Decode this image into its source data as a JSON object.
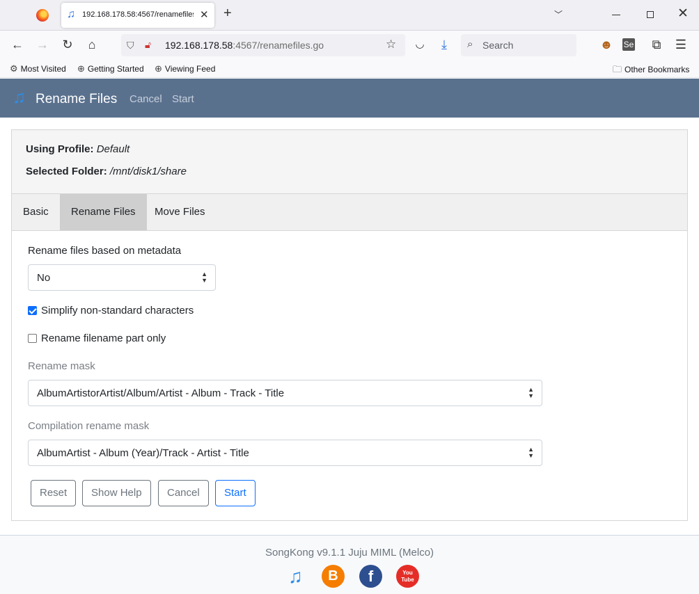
{
  "browser": {
    "tab_title": "192.168.178.58:4567/renamefiles.go",
    "new_tab_symbol": "+",
    "url_host": "192.168.178.58",
    "url_rest": ":4567/renamefiles.go",
    "search_placeholder": "Search",
    "bookmarks": [
      {
        "label": "Most Visited",
        "icon": "gear-icon"
      },
      {
        "label": "Getting Started",
        "icon": "globe-icon"
      },
      {
        "label": "Viewing Feed",
        "icon": "globe-icon"
      },
      {
        "label": "Other Bookmarks",
        "icon": "folder-icon"
      }
    ]
  },
  "app": {
    "brand": "Rename Files",
    "nav": {
      "cancel": "Cancel",
      "start": "Start"
    },
    "profile_label": "Using Profile:",
    "profile_value": "Default",
    "folder_label": "Selected Folder:",
    "folder_value": "/mnt/disk1/share",
    "tabs": [
      {
        "label": "Basic",
        "active": false
      },
      {
        "label": "Rename Files",
        "active": true
      },
      {
        "label": "Move Files",
        "active": false
      }
    ],
    "form": {
      "rename_metadata_label": "Rename files based on metadata",
      "rename_metadata_value": "No",
      "simplify_label": "Simplify non-standard characters",
      "simplify_checked": true,
      "filename_only_label": "Rename filename part only",
      "filename_only_checked": false,
      "mask_label": "Rename mask",
      "mask_value": "AlbumArtistorArtist/Album/Artist - Album - Track - Title",
      "compilation_label": "Compilation rename mask",
      "compilation_value": "AlbumArtist - Album (Year)/Track - Artist - Title"
    },
    "buttons": {
      "reset": "Reset",
      "help": "Show Help",
      "cancel": "Cancel",
      "start": "Start"
    },
    "footer": "SongKong v9.1.1 Juju MIML (Melco)",
    "social": [
      {
        "icon": "songkong-icon",
        "color": "#2c8fe8"
      },
      {
        "icon": "blogger-icon",
        "color": "#f57d00",
        "glyph": "B"
      },
      {
        "icon": "facebook-icon",
        "color": "#2d4f8f",
        "glyph": "f"
      },
      {
        "icon": "youtube-icon",
        "color": "#e52d27",
        "glyph": "You Tube"
      }
    ]
  }
}
